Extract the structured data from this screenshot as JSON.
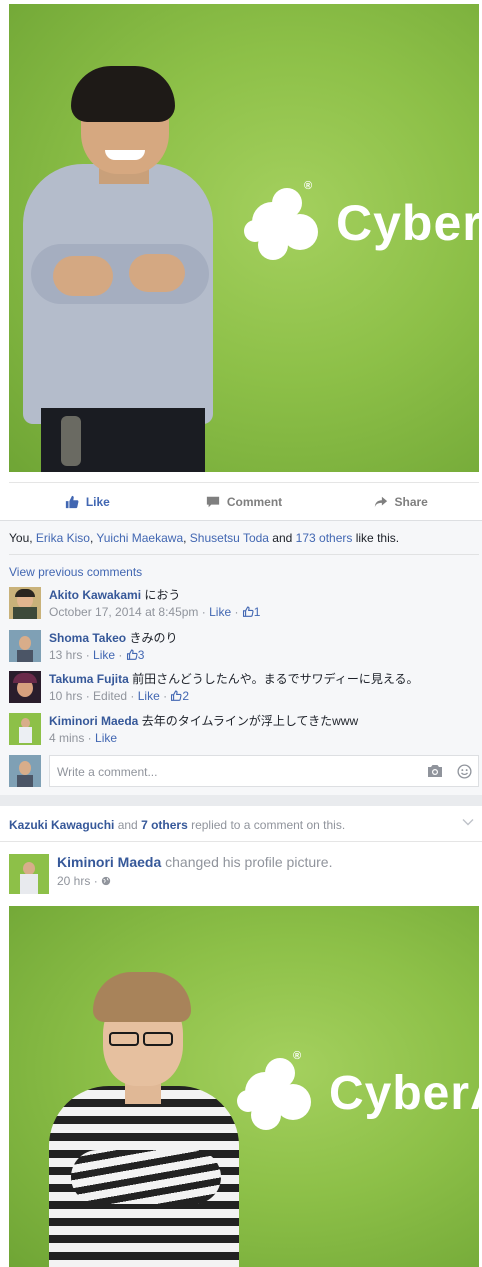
{
  "post1": {
    "photo": {
      "brand_text": "CyberA",
      "registered_mark": "®"
    },
    "actions": {
      "like": "Like",
      "comment": "Comment",
      "share": "Share"
    },
    "likes": {
      "prefix": "You, ",
      "names": [
        "Erika Kiso",
        "Yuichi Maekawa",
        "Shusetsu Toda"
      ],
      "sep1": ", ",
      "and": " and ",
      "others": "173 others",
      "suffix": " like this."
    },
    "view_previous": "View previous comments",
    "comments": [
      {
        "author": "Akito Kawakami",
        "text": "におう",
        "meta_time": "October 17, 2014 at 8:45pm",
        "meta_edited": "",
        "like_label": "Like",
        "like_count": "1"
      },
      {
        "author": "Shoma Takeo",
        "text": "きみのり",
        "meta_time": "13 hrs",
        "meta_edited": "",
        "like_label": "Like",
        "like_count": "3"
      },
      {
        "author": "Takuma Fujita",
        "text": "前田さんどうしたんや。まるでサワディーに見える。",
        "meta_time": "10 hrs",
        "meta_edited": "Edited",
        "like_label": "Like",
        "like_count": "2"
      },
      {
        "author": "Kiminori Maeda",
        "text": "去年のタイムラインが浮上してきたwww",
        "meta_time": "4 mins",
        "meta_edited": "",
        "like_label": "Like",
        "like_count": ""
      }
    ],
    "write_placeholder": "Write a comment..."
  },
  "post2": {
    "replied": {
      "name": "Kazuki Kawaguchi",
      "rest": " and ",
      "others": "7 others",
      "tail": " replied to a comment on this."
    },
    "header": {
      "author": "Kiminori Maeda",
      "action": " changed his profile picture.",
      "time": "20 hrs",
      "privacy_icon": "globe-icon"
    },
    "photo": {
      "brand_text": "CyberA",
      "registered_mark": "®"
    }
  },
  "colors": {
    "brand_green": "#8dc048",
    "link_blue": "#365899",
    "like_blue": "#4267b2",
    "meta_grey": "#90949c"
  }
}
